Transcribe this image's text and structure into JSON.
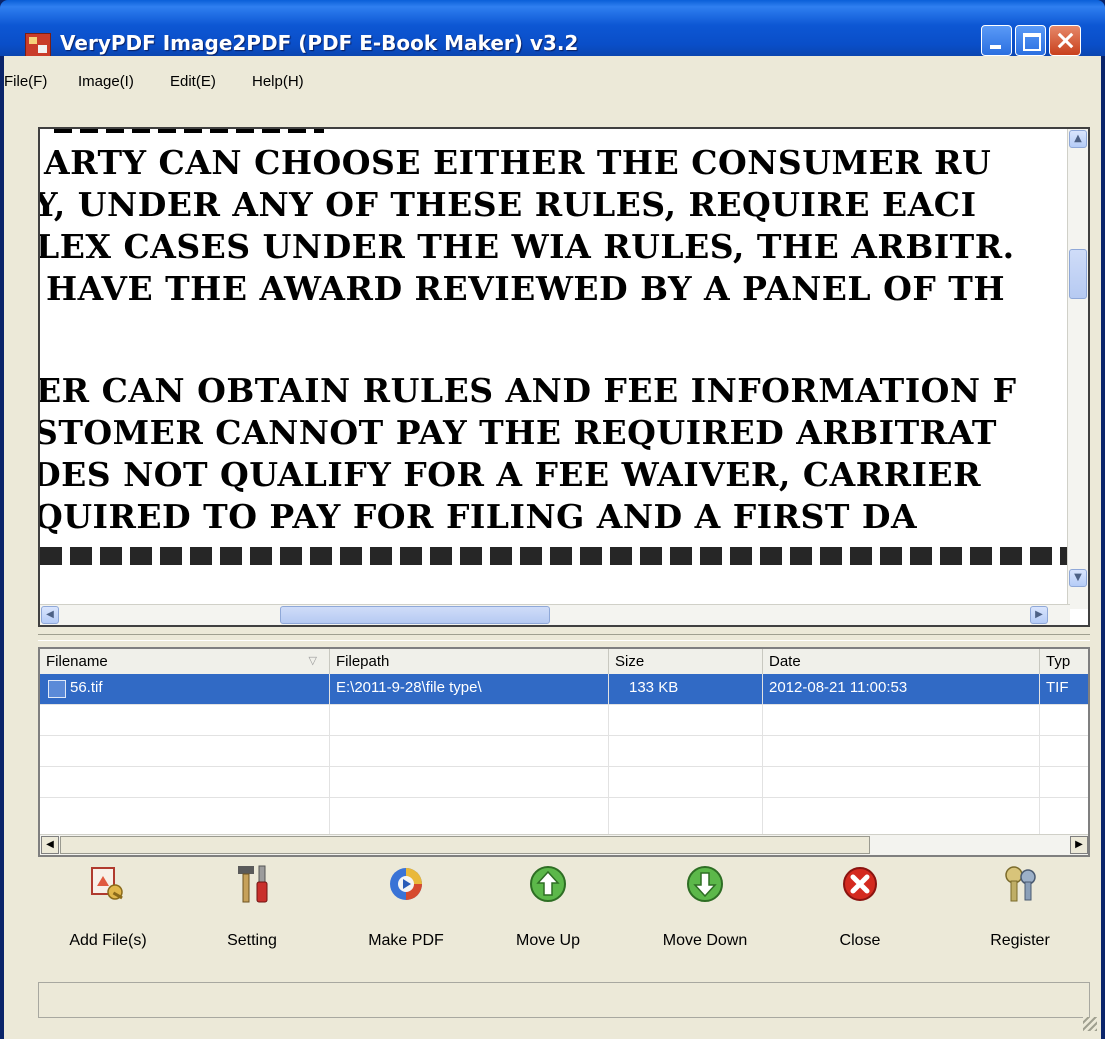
{
  "window": {
    "title": "VeryPDF Image2PDF (PDF E-Book Maker) v3.2"
  },
  "menu": [
    "File(F)",
    "Image(I)",
    "Edit(E)",
    "Help(H)"
  ],
  "preview": {
    "lines": [
      "ARTY CAN CHOOSE EITHER THE CONSUMER RU",
      "Y, UNDER ANY OF THESE RULES, REQUIRE EACI",
      "LEX CASES UNDER THE WIA RULES, THE ARBITR.",
      "HAVE THE AWARD REVIEWED BY A PANEL OF TH",
      "ER CAN OBTAIN RULES AND FEE INFORMATION F",
      "STOMER CANNOT PAY THE REQUIRED ARBITRAT",
      "DES NOT QUALIFY FOR A FEE WAIVER, CARRIER",
      "QUIRED TO PAY FOR FILING AND A FIRST DA"
    ]
  },
  "file_list": {
    "columns": [
      "Filename",
      "Filepath",
      "Size",
      "Date",
      "Typ"
    ],
    "rows": [
      {
        "filename": "56.tif",
        "filepath": "E:\\2011-9-28\\file type\\",
        "size": "133 KB",
        "date": "2012-08-21 11:00:53",
        "type": "TIF"
      }
    ]
  },
  "toolbar": {
    "add_files": "Add File(s)",
    "setting": "Setting",
    "make_pdf": "Make PDF",
    "move_up": "Move Up",
    "move_down": "Move Down",
    "close": "Close",
    "register": "Register"
  },
  "icons": {
    "add_files": "add-file-icon",
    "setting": "tools-icon",
    "make_pdf": "make-pdf-icon",
    "move_up": "arrow-up-circle-icon",
    "move_down": "arrow-down-circle-icon",
    "close": "close-circle-icon",
    "register": "keys-icon"
  },
  "colors": {
    "titlebar": "#0a4ec8",
    "selection": "#316ac5",
    "window_bg": "#ece9d8",
    "close_red": "#d42a1f",
    "move_green": "#3d9a3a"
  }
}
